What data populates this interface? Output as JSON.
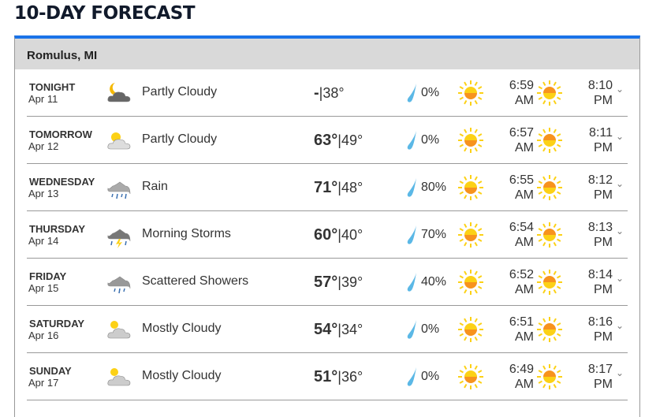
{
  "title": "10-DAY FORECAST",
  "location": "Romulus, MI",
  "colors": {
    "accent": "#1a73e8",
    "drop": "#5bb8e6",
    "sun": "#fcd116",
    "sun_half": "#f7931e"
  },
  "days": [
    {
      "day": "TONIGHT",
      "date": "Apr 11",
      "icon": "night-partly-cloudy-icon",
      "condition": "Partly Cloudy",
      "high": "-",
      "low": "38°",
      "precip": "0%",
      "sunrise": "6:59",
      "sunrise_ampm": "AM",
      "sunset": "8:10",
      "sunset_ampm": "PM"
    },
    {
      "day": "TOMORROW",
      "date": "Apr 12",
      "icon": "partly-cloudy-icon",
      "condition": "Partly Cloudy",
      "high": "63°",
      "low": "49°",
      "precip": "0%",
      "sunrise": "6:57",
      "sunrise_ampm": "AM",
      "sunset": "8:11",
      "sunset_ampm": "PM"
    },
    {
      "day": "WEDNESDAY",
      "date": "Apr 13",
      "icon": "rain-icon",
      "condition": "Rain",
      "high": "71°",
      "low": "48°",
      "precip": "80%",
      "sunrise": "6:55",
      "sunrise_ampm": "AM",
      "sunset": "8:12",
      "sunset_ampm": "PM"
    },
    {
      "day": "THURSDAY",
      "date": "Apr 14",
      "icon": "storm-icon",
      "condition": "Morning Storms",
      "high": "60°",
      "low": "40°",
      "precip": "70%",
      "sunrise": "6:54",
      "sunrise_ampm": "AM",
      "sunset": "8:13",
      "sunset_ampm": "PM"
    },
    {
      "day": "FRIDAY",
      "date": "Apr 15",
      "icon": "showers-icon",
      "condition": "Scattered Showers",
      "high": "57°",
      "low": "39°",
      "precip": "40%",
      "sunrise": "6:52",
      "sunrise_ampm": "AM",
      "sunset": "8:14",
      "sunset_ampm": "PM"
    },
    {
      "day": "SATURDAY",
      "date": "Apr 16",
      "icon": "mostly-cloudy-icon",
      "condition": "Mostly Cloudy",
      "high": "54°",
      "low": "34°",
      "precip": "0%",
      "sunrise": "6:51",
      "sunrise_ampm": "AM",
      "sunset": "8:16",
      "sunset_ampm": "PM"
    },
    {
      "day": "SUNDAY",
      "date": "Apr 17",
      "icon": "mostly-cloudy-icon",
      "condition": "Mostly Cloudy",
      "high": "51°",
      "low": "36°",
      "precip": "0%",
      "sunrise": "6:49",
      "sunrise_ampm": "AM",
      "sunset": "8:17",
      "sunset_ampm": "PM"
    }
  ]
}
